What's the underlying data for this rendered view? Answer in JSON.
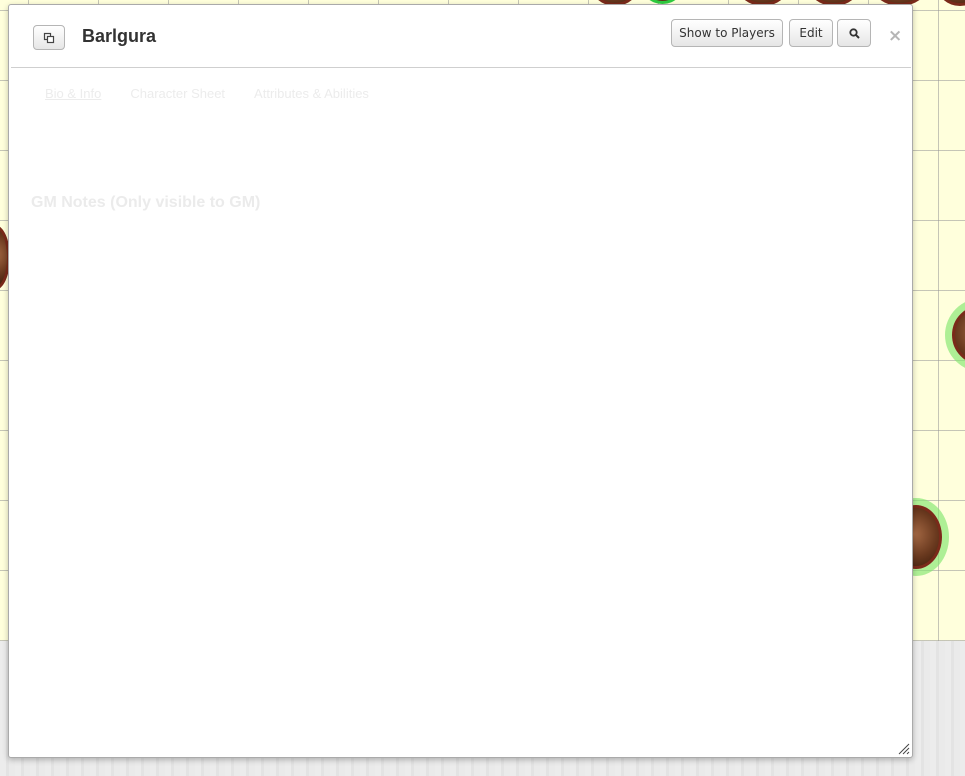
{
  "window": {
    "title": "Barlgura",
    "buttons": {
      "show_to_players": "Show to Players",
      "edit": "Edit"
    },
    "close_symbol": "×"
  },
  "tabs": [
    {
      "label": "Bio & Info",
      "active": true
    },
    {
      "label": "Character Sheet",
      "active": false
    },
    {
      "label": "Attributes & Abilities",
      "active": false
    }
  ],
  "gm_notes": {
    "heading": "GM Notes (Only visible to GM)"
  },
  "icons": {
    "popout": "popout-icon",
    "search": "search-icon",
    "close": "close-icon",
    "resize": "resize-handle-icon"
  },
  "colors": {
    "map_background": "#ffffdc",
    "grid": "#969696",
    "token_border": "#7a2a1a",
    "token_glow": "#82e66e"
  }
}
